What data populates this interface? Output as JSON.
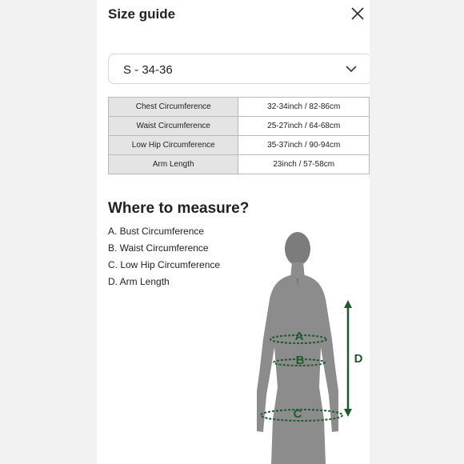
{
  "header": {
    "title": "Size guide",
    "close_icon": "close-icon"
  },
  "size_select": {
    "value": "S - 34-36",
    "icon": "chevron-down-icon"
  },
  "size_table": [
    {
      "label": "Chest Circumference",
      "value": "32-34inch / 82-86cm"
    },
    {
      "label": "Waist Circumference",
      "value": "25-27inch / 64-68cm"
    },
    {
      "label": "Low Hip Circumference",
      "value": "35-37inch / 90-94cm"
    },
    {
      "label": "Arm Length",
      "value": "23inch / 57-58cm"
    }
  ],
  "measure": {
    "heading": "Where to measure?",
    "items": [
      "A. Bust Circumference",
      "B. Waist Circumference",
      "C. Low Hip Circumference",
      "D. Arm Length"
    ],
    "figure_labels": {
      "a": "A",
      "b": "B",
      "c": "C",
      "d": "D"
    }
  },
  "colors": {
    "accent_green": "#1e5a2e",
    "silhouette": "#8a8a8a"
  }
}
